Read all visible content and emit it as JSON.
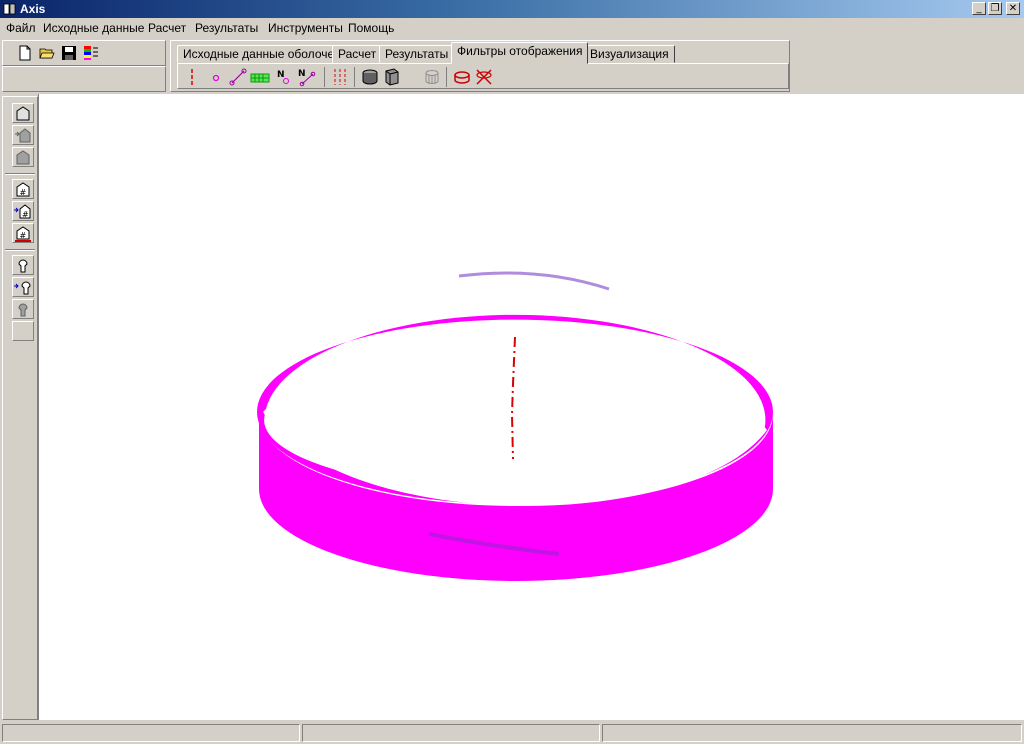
{
  "window": {
    "title": "Axis",
    "minimize": "_",
    "restore": "❐",
    "close": "✕"
  },
  "menu": [
    {
      "label": "Файл"
    },
    {
      "label": "Исходные данные"
    },
    {
      "label": "Расчет"
    },
    {
      "label": "Результаты"
    },
    {
      "label": "Инструменты"
    },
    {
      "label": "Помощь"
    }
  ],
  "toolbar": {
    "icons": [
      "new-file-icon",
      "open-folder-icon",
      "save-icon",
      "color-palette-icon"
    ]
  },
  "tabs": [
    {
      "label": "Исходные данные оболочек",
      "active": false
    },
    {
      "label": "Расчет",
      "active": false
    },
    {
      "label": "Результаты",
      "active": false
    },
    {
      "label": "Фильтры отображения",
      "active": true
    },
    {
      "label": "Визуализация",
      "active": false
    }
  ],
  "filter_tools": {
    "node_number_label": "N",
    "element_number_label": "N"
  },
  "colors": {
    "shell": "#ff00ff",
    "shell_shade": "#7030c0",
    "axis_line": "#dd0000"
  }
}
